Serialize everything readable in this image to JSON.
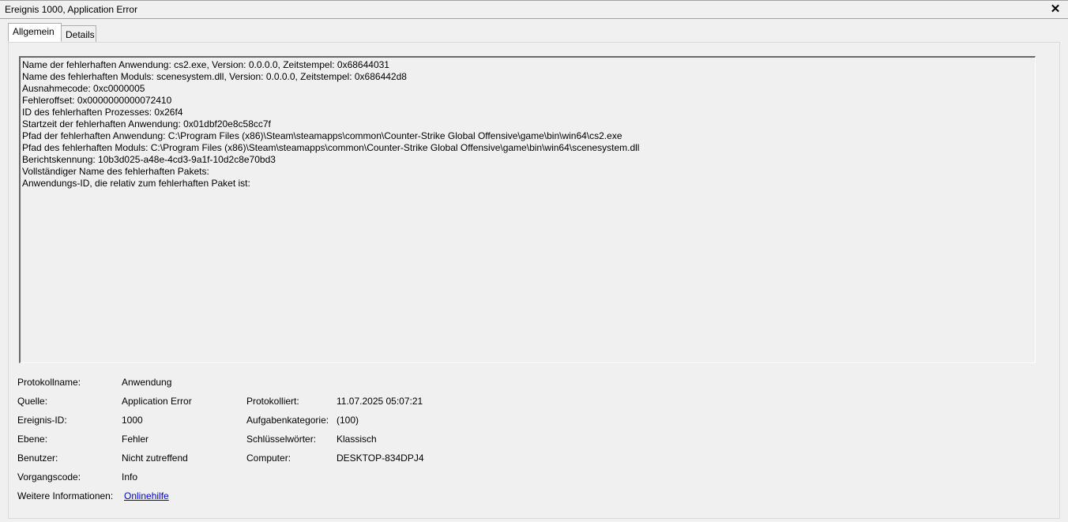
{
  "window": {
    "title": "Ereignis 1000, Application Error",
    "close_glyph": "✕"
  },
  "tabs": [
    {
      "label": "Allgemein",
      "active": true
    },
    {
      "label": "Details",
      "active": false
    }
  ],
  "description_lines": [
    "Name der fehlerhaften Anwendung: cs2.exe, Version: 0.0.0.0, Zeitstempel: 0x68644031",
    "Name des fehlerhaften Moduls: scenesystem.dll, Version: 0.0.0.0, Zeitstempel: 0x686442d8",
    "Ausnahmecode: 0xc0000005",
    "Fehleroffset: 0x0000000000072410",
    "ID des fehlerhaften Prozesses: 0x26f4",
    "Startzeit der fehlerhaften Anwendung: 0x01dbf20e8c58cc7f",
    "Pfad der fehlerhaften Anwendung: C:\\Program Files (x86)\\Steam\\steamapps\\common\\Counter-Strike Global Offensive\\game\\bin\\win64\\cs2.exe",
    "Pfad des fehlerhaften Moduls: C:\\Program Files (x86)\\Steam\\steamapps\\common\\Counter-Strike Global Offensive\\game\\bin\\win64\\scenesystem.dll",
    "Berichtskennung: 10b3d025-a48e-4cd3-9a1f-10d2c8e70bd3",
    "Vollständiger Name des fehlerhaften Pakets:",
    "Anwendungs-ID, die relativ zum fehlerhaften Paket ist:"
  ],
  "properties": {
    "log_name": {
      "label": "Protokollname:",
      "value": "Anwendung"
    },
    "source": {
      "label": "Quelle:",
      "value": "Application Error"
    },
    "logged": {
      "label": "Protokolliert:",
      "value": "11.07.2025 05:07:21"
    },
    "event_id": {
      "label": "Ereignis-ID:",
      "value": "1000"
    },
    "task_category": {
      "label": "Aufgabenkategorie:",
      "value": "(100)"
    },
    "level": {
      "label": "Ebene:",
      "value": "Fehler"
    },
    "keywords": {
      "label": "Schlüsselwörter:",
      "value": "Klassisch"
    },
    "user": {
      "label": "Benutzer:",
      "value": "Nicht zutreffend"
    },
    "computer": {
      "label": "Computer:",
      "value": "DESKTOP-834DPJ4"
    },
    "opcode": {
      "label": "Vorgangscode:",
      "value": "Info"
    },
    "more_info": {
      "label": "Weitere Informationen:",
      "link": "Onlinehilfe"
    }
  }
}
